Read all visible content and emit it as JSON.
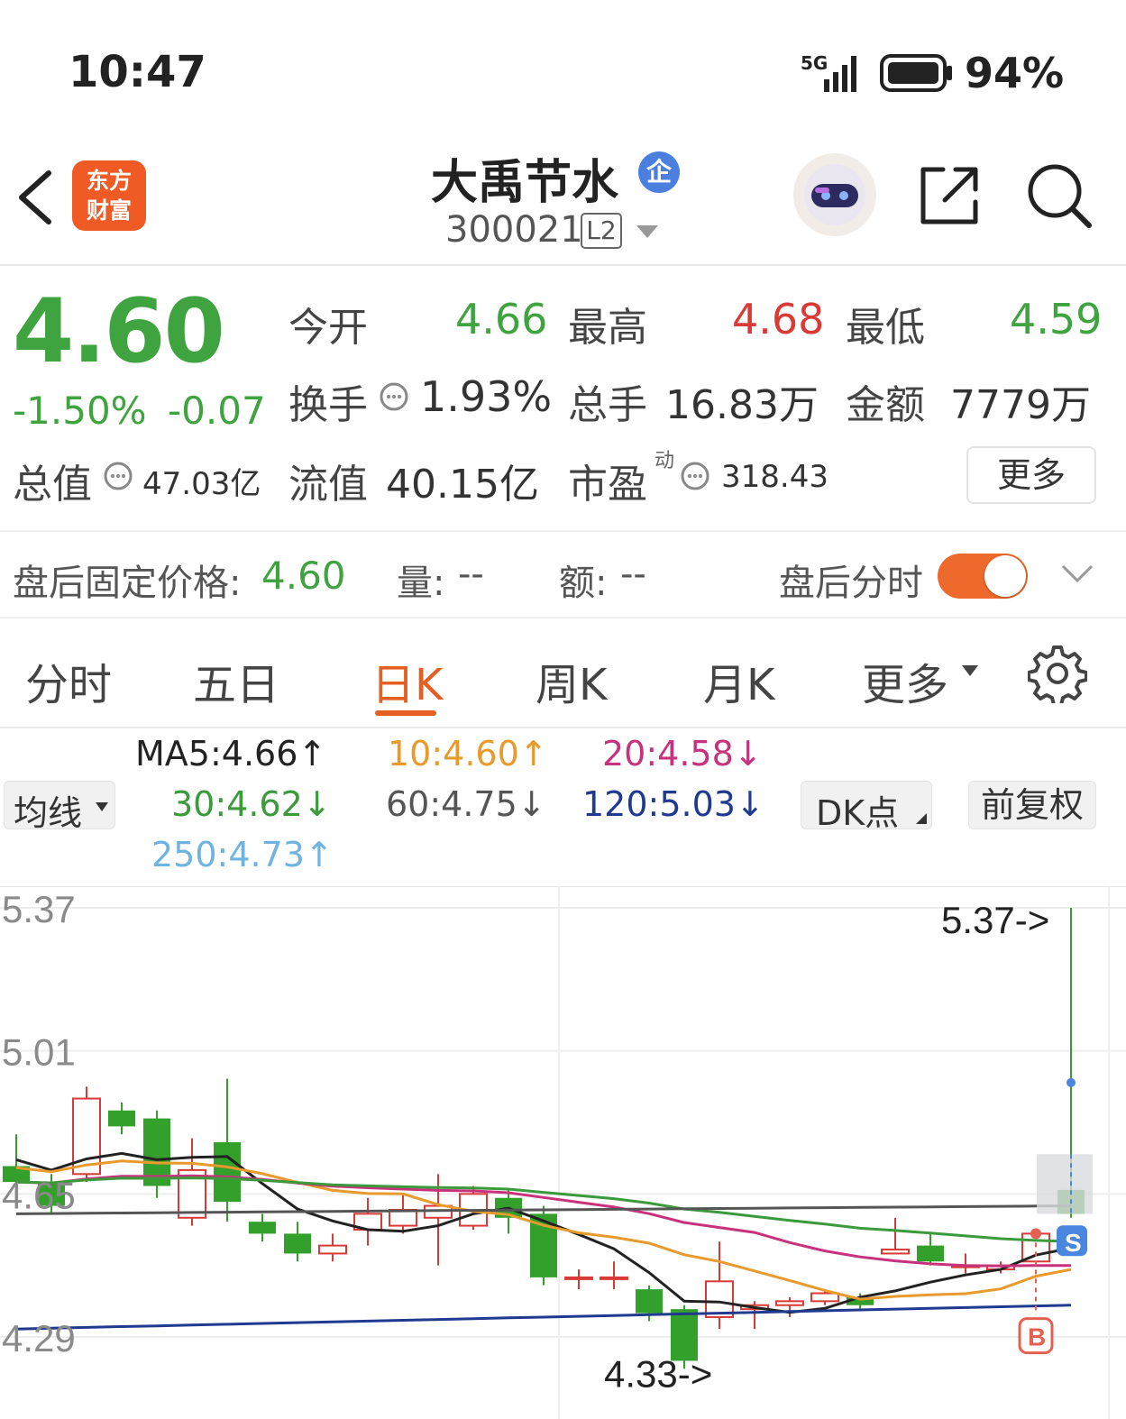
{
  "status_bar": {
    "time": "10:47",
    "network": "5G",
    "battery": "94%"
  },
  "header": {
    "app_logo_text": "东方\n财富",
    "stock_name": "大禹节水",
    "stock_badge": "企",
    "stock_code": "300021",
    "level_badge": "L2"
  },
  "quote": {
    "price": "4.60",
    "change_pct": "-1.50%",
    "change": "-0.07",
    "open_label": "今开",
    "open": "4.66",
    "high_label": "最高",
    "high": "4.68",
    "low_label": "最低",
    "low": "4.59",
    "turnover_label": "换手",
    "turnover": "1.93%",
    "volume_label": "总手",
    "volume": "16.83万",
    "amount_label": "金额",
    "amount": "7779万",
    "total_cap_label": "总值",
    "total_cap": "47.03亿",
    "float_cap_label": "流值",
    "float_cap": "40.15亿",
    "pe_label": "市盈",
    "pe_sup": "动",
    "pe": "318.43",
    "more_button": "更多"
  },
  "after_hours": {
    "price_label": "盘后固定价格:",
    "price": "4.60",
    "vol_label": "量:",
    "vol": "--",
    "amt_label": "额:",
    "amt": "--",
    "toggle_label": "盘后分时"
  },
  "tabs": [
    {
      "label": "分时"
    },
    {
      "label": "五日"
    },
    {
      "label": "日K",
      "active": true
    },
    {
      "label": "周K"
    },
    {
      "label": "月K"
    },
    {
      "label": "更多"
    }
  ],
  "ma": {
    "mode_button": "均线",
    "ma5": "MA5:4.66↑",
    "ma10": "10:4.60↑",
    "ma20": "20:4.58↓",
    "ma30": "30:4.62↓",
    "ma60": "60:4.75↓",
    "ma120": "120:5.03↓",
    "ma250": "250:4.73↑",
    "dk_button": "DK点",
    "adjust_button": "前复权",
    "colors": {
      "ma5": "#222222",
      "ma10": "#e89a2c",
      "ma20": "#c8327d",
      "ma30": "#3b9a3b",
      "ma60": "#555555",
      "ma120": "#1f3a8f",
      "ma250": "#6fb3e0"
    }
  },
  "chart_data": {
    "type": "candlestick",
    "y_ticks": [
      "5.37",
      "5.01",
      "4.65",
      "4.29"
    ],
    "ylim": [
      4.29,
      5.37
    ],
    "max_label": "5.37->",
    "min_label": "4.33->",
    "markers": {
      "sell": "S",
      "buy": "B"
    },
    "candles": [
      {
        "o": 4.72,
        "c": 4.68,
        "h": 4.8,
        "l": 4.66
      },
      {
        "o": 4.68,
        "c": 4.62,
        "h": 4.7,
        "l": 4.6
      },
      {
        "o": 4.7,
        "c": 4.89,
        "h": 4.92,
        "l": 4.68
      },
      {
        "o": 4.86,
        "c": 4.82,
        "h": 4.88,
        "l": 4.8
      },
      {
        "o": 4.84,
        "c": 4.67,
        "h": 4.86,
        "l": 4.64
      },
      {
        "o": 4.59,
        "c": 4.71,
        "h": 4.79,
        "l": 4.57
      },
      {
        "o": 4.78,
        "c": 4.63,
        "h": 4.94,
        "l": 4.58
      },
      {
        "o": 4.58,
        "c": 4.55,
        "h": 4.6,
        "l": 4.53
      },
      {
        "o": 4.55,
        "c": 4.5,
        "h": 4.58,
        "l": 4.48
      },
      {
        "o": 4.5,
        "c": 4.52,
        "h": 4.55,
        "l": 4.48
      },
      {
        "o": 4.56,
        "c": 4.6,
        "h": 4.64,
        "l": 4.52
      },
      {
        "o": 4.57,
        "c": 4.61,
        "h": 4.65,
        "l": 4.55
      },
      {
        "o": 4.59,
        "c": 4.62,
        "h": 4.7,
        "l": 4.47
      },
      {
        "o": 4.57,
        "c": 4.65,
        "h": 4.67,
        "l": 4.56
      },
      {
        "o": 4.64,
        "c": 4.59,
        "h": 4.66,
        "l": 4.55
      },
      {
        "o": 4.6,
        "c": 4.44,
        "h": 4.62,
        "l": 4.42
      },
      {
        "o": 4.44,
        "c": 4.44,
        "h": 4.46,
        "l": 4.41
      },
      {
        "o": 4.44,
        "c": 4.44,
        "h": 4.48,
        "l": 4.41
      },
      {
        "o": 4.41,
        "c": 4.35,
        "h": 4.42,
        "l": 4.33
      },
      {
        "o": 4.36,
        "c": 4.23,
        "h": 4.37,
        "l": 4.21
      },
      {
        "o": 4.34,
        "c": 4.43,
        "h": 4.53,
        "l": 4.31
      },
      {
        "o": 4.36,
        "c": 4.37,
        "h": 4.38,
        "l": 4.31
      },
      {
        "o": 4.37,
        "c": 4.38,
        "h": 4.39,
        "l": 4.34
      },
      {
        "o": 4.38,
        "c": 4.4,
        "h": 4.41,
        "l": 4.37
      },
      {
        "o": 4.39,
        "c": 4.37,
        "h": 4.4,
        "l": 4.36
      },
      {
        "o": 4.5,
        "c": 4.51,
        "h": 4.59,
        "l": 4.5
      },
      {
        "o": 4.52,
        "c": 4.48,
        "h": 4.55,
        "l": 4.47
      },
      {
        "o": 4.47,
        "c": 4.47,
        "h": 4.5,
        "l": 4.45
      },
      {
        "o": 4.46,
        "c": 4.47,
        "h": 4.48,
        "l": 4.45
      },
      {
        "o": 4.48,
        "c": 4.55,
        "h": 4.56,
        "l": 4.47
      },
      {
        "o": 4.66,
        "c": 4.6,
        "h": 5.37,
        "l": 4.59
      }
    ]
  }
}
